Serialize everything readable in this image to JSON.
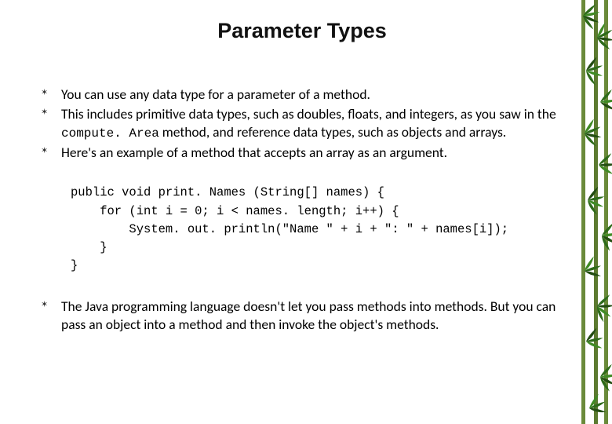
{
  "title": "Parameter Types",
  "bullets1": [
    "You can use any data type for a parameter of a method.",
    {
      "prefix": "This includes primitive data types, such as doubles, floats, and integers, as you saw in the ",
      "code": "compute. Area",
      "suffix": " method, and reference data types, such as objects and arrays."
    },
    "Here's an example of a method that accepts an array as an argument."
  ],
  "code": "public void print. Names (String[] names) {\n    for (int i = 0; i < names. length; i++) {\n        System. out. println(\"Name \" + i + \": \" + names[i]);\n    }\n}",
  "bullets2": [
    "The Java programming language doesn't let you pass methods into methods. But you can pass an object into a method and then invoke the object's methods."
  ]
}
